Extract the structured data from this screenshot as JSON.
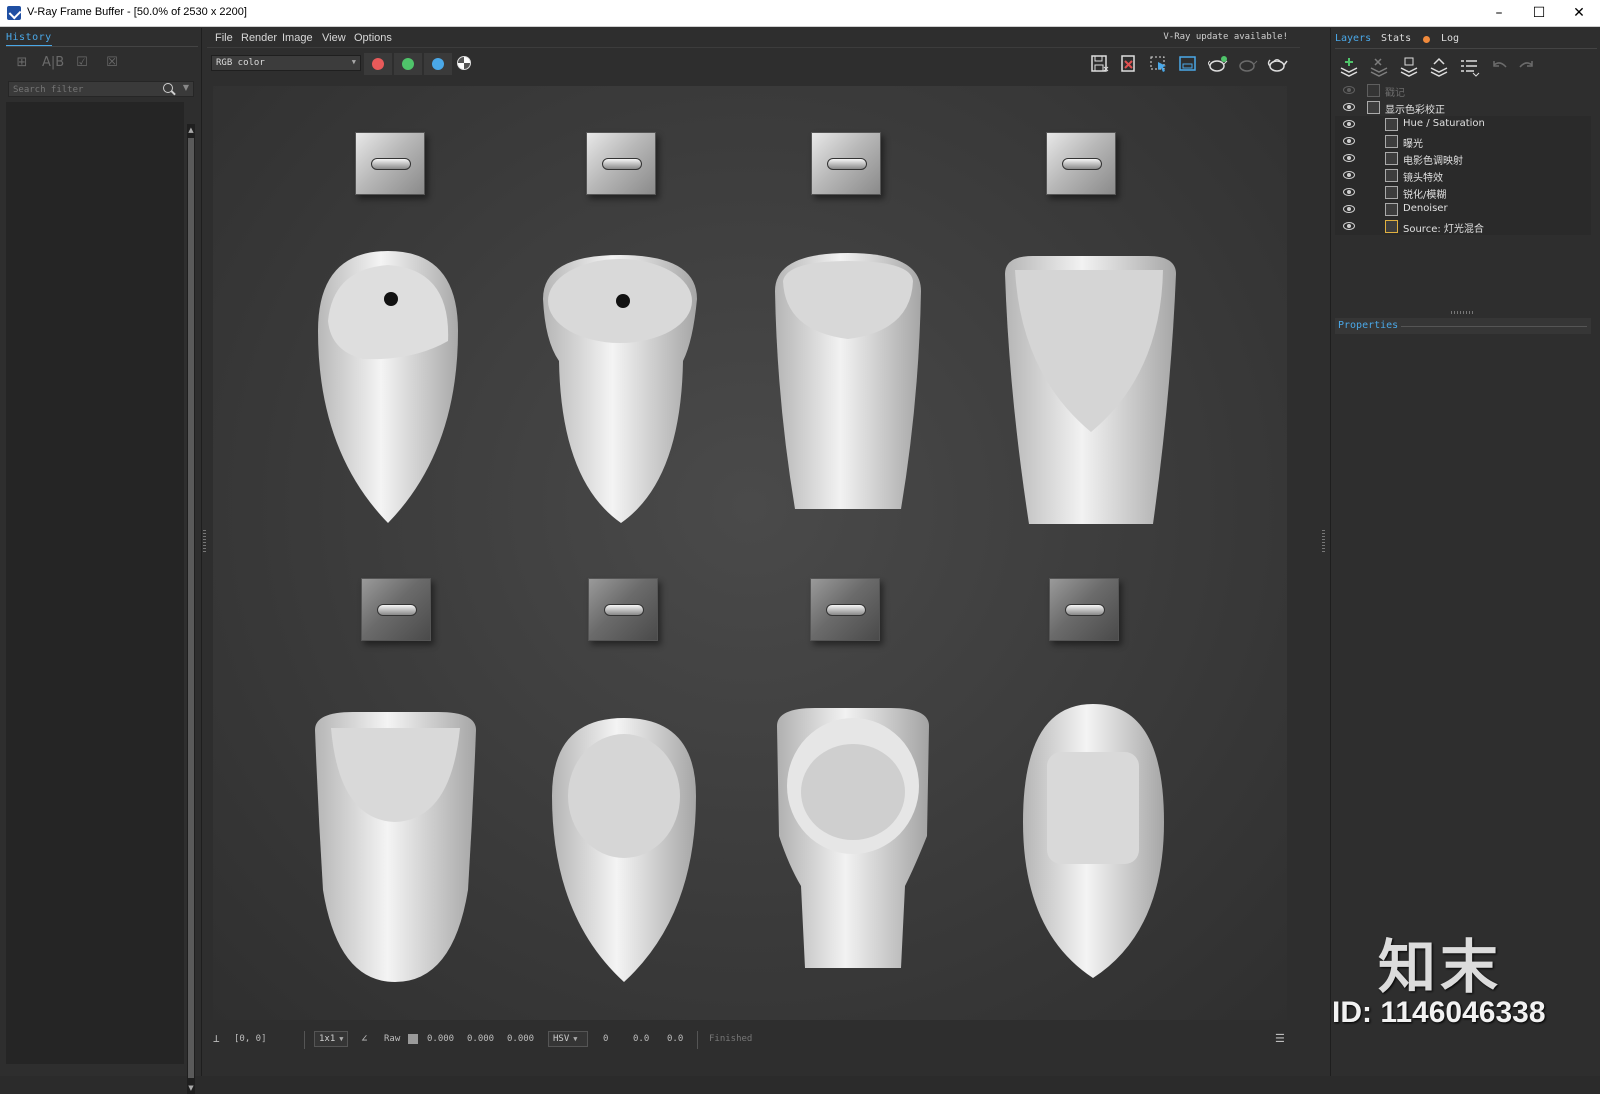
{
  "window": {
    "title": "V-Ray Frame Buffer - [50.0% of 2530 x 2200]",
    "minimize": "–",
    "maximize": "☐",
    "close": "✕"
  },
  "history_panel": {
    "tab_label": "History",
    "search_placeholder": "Search filter",
    "tools": [
      "save-to-history-icon",
      "ab-compare-icon",
      "load-history-icon",
      "remove-history-icon"
    ]
  },
  "menu": {
    "items": [
      "File",
      "Render",
      "Image",
      "View",
      "Options"
    ],
    "update_notice": "V-Ray update available!"
  },
  "toolbar": {
    "channel": "RGB color",
    "channel_buttons": [
      {
        "name": "red-channel",
        "color": "#e85a5a"
      },
      {
        "name": "green-channel",
        "color": "#4fc46a"
      },
      {
        "name": "blue-channel",
        "color": "#4aa8e8"
      }
    ],
    "right_tools": [
      "save-image-icon",
      "clear-image-icon",
      "region-render-icon",
      "track-mouse-icon",
      "render-icon",
      "render-interactive-icon",
      "teapot-icon"
    ]
  },
  "statusbar": {
    "coords": "[0, 0]",
    "zoom": "1x1",
    "raw_label": "Raw",
    "rgb_values": [
      "0.000",
      "0.000",
      "0.000"
    ],
    "color_mode": "HSV",
    "hsv_values": [
      "0",
      "0.0",
      "0.0"
    ],
    "status": "Finished"
  },
  "right_panel": {
    "tabs": [
      "Layers",
      "Stats",
      "Log"
    ],
    "layers": [
      {
        "name": "戳记",
        "visible": false,
        "indent": 0
      },
      {
        "name": "显示色彩校正",
        "visible": true,
        "indent": 0
      },
      {
        "name": "Hue / Saturation",
        "visible": true,
        "indent": 1
      },
      {
        "name": "曝光",
        "visible": true,
        "indent": 1
      },
      {
        "name": "电影色调映射",
        "visible": true,
        "indent": 1
      },
      {
        "name": "镜头特效",
        "visible": true,
        "indent": 1
      },
      {
        "name": "锐化/模糊",
        "visible": true,
        "indent": 1
      },
      {
        "name": "Denoiser",
        "visible": true,
        "indent": 1
      },
      {
        "name": "Source: 灯光混合",
        "visible": true,
        "indent": 1
      }
    ],
    "properties_label": "Properties"
  },
  "watermark": {
    "brand": "知末",
    "id": "ID: 1146046338"
  }
}
